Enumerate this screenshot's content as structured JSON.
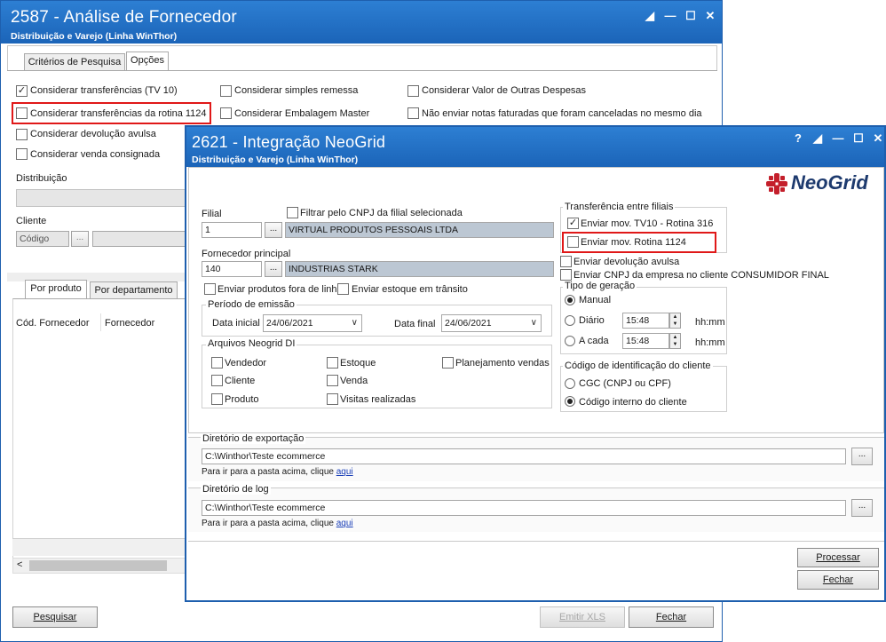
{
  "win1": {
    "title": "2587 - Análise de Fornecedor",
    "subtitle": "Distribuição e Varejo (Linha WinThor)",
    "tabs": [
      "Critérios de Pesquisa",
      "Opções"
    ],
    "checks": [
      {
        "label": "Considerar transferências (TV 10)",
        "mark": "✓"
      },
      {
        "label": "Considerar transferências da rotina 1124",
        "mark": ""
      },
      {
        "label": "Considerar devolução avulsa",
        "mark": ""
      },
      {
        "label": "Considerar venda consignada",
        "mark": ""
      },
      {
        "label": "Considerar simples remessa",
        "mark": ""
      },
      {
        "label": "Considerar Embalagem Master",
        "mark": ""
      },
      {
        "label": "Considerar Valor de Outras Despesas",
        "mark": ""
      },
      {
        "label": "Não enviar notas faturadas que foram canceladas no mesmo dia",
        "mark": ""
      }
    ],
    "distribuicao_label": "Distribuição",
    "cliente_label": "Cliente",
    "cliente_codigo": "Código",
    "ellipsis": "...",
    "bottom_tabs": [
      "Por produto",
      "Por departamento"
    ],
    "col_cod_fornecedor": "Cód. Fornecedor",
    "col_fornecedor": "Fornecedor",
    "scroll_left": "<",
    "btn_pesquisar": "Pesquisar",
    "btn_emitir_xls": "Emitir XLS",
    "btn_fechar": "Fechar"
  },
  "win2": {
    "title": "2621 - Integração NeoGrid",
    "subtitle": "Distribuição e Varejo (Linha WinThor)",
    "help": "?",
    "logo": "NeoGrid",
    "filial_label": "Filial",
    "filtrar_cnpj": "Filtrar pelo CNPJ da filial selecionada",
    "filial_code": "1",
    "filial_name": "VIRTUAL PRODUTOS PESSOAIS LTDA",
    "fornecedor_label": "Fornecedor principal",
    "fornecedor_code": "140",
    "fornecedor_name": "INDUSTRIAS STARK",
    "ellipsis": "...",
    "enviar_fora_linha": "Enviar produtos fora de linha",
    "enviar_estoque_transito": "Enviar estoque em trânsito",
    "periodo_title": "Período de emissão",
    "data_inicial_label": "Data inicial",
    "data_inicial": "24/06/2021",
    "data_final_label": "Data final",
    "data_final": "24/06/2021",
    "arquivos_title": "Arquivos Neogrid DI",
    "arquivos": [
      "Vendedor",
      "Cliente",
      "Produto",
      "Estoque",
      "Venda",
      "Visitas realizadas",
      "Planejamento vendas"
    ],
    "transf_title": "Transferência entre filiais",
    "enviar_tv10": "Enviar mov. TV10 - Rotina 316",
    "enviar_1124": "Enviar mov. Rotina 1124",
    "enviar_devolucao": "Enviar devolução avulsa",
    "enviar_cnpj": "Enviar CNPJ da empresa no cliente CONSUMIDOR FINAL",
    "tipo_title": "Tipo de geração",
    "manual": "Manual",
    "diario": "Diário",
    "a_cada": "A cada",
    "time_diario": "15:48",
    "time_a_cada": "15:48",
    "hhmm": "hh:mm",
    "codigo_title": "Código de identificação do cliente",
    "cgc": "CGC (CNPJ ou CPF)",
    "codigo_interno": "Código interno do cliente",
    "dir_export_title": "Diretório de exportação",
    "dir_export": "C:\\Winthor\\Teste ecommerce",
    "dir_log_title": "Diretório de log",
    "dir_log": "C:\\Winthor\\Teste ecommerce",
    "para_ir": "Para ir para a pasta acima, clique",
    "aqui": "aqui",
    "btn_processar": "Processar",
    "btn_fechar": "Fechar"
  }
}
